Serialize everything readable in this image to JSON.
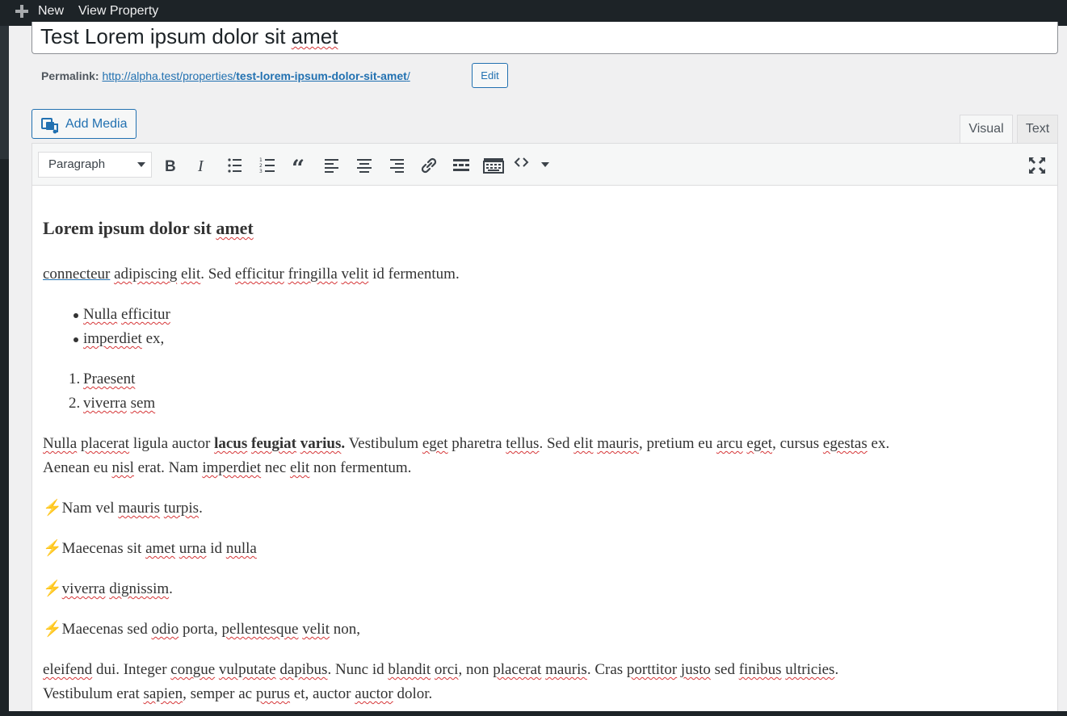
{
  "adminbar": {
    "new_label": "New",
    "view_label": "View Property"
  },
  "title": {
    "value_a": "Test Lorem ipsum dolor sit ",
    "value_b": "amet"
  },
  "permalink": {
    "label": "Permalink:",
    "url_base": "http://alpha.test/properties/",
    "slug": "test-lorem-ipsum-dolor-sit-amet",
    "url_end": "/",
    "edit_label": "Edit"
  },
  "media": {
    "add_media_label": "Add Media"
  },
  "tabs": {
    "visual": "Visual",
    "text": "Text"
  },
  "toolbar": {
    "format_value": "Paragraph"
  },
  "content": {
    "heading_a": "Lorem ipsum dolor sit ",
    "heading_b": "amet",
    "p1_a": "connecteur",
    "p1_b": "adipiscing",
    "p1_c": "elit",
    "p1_d": ". Sed ",
    "p1_e": "efficitur",
    "p1_f": "fringilla",
    "p1_g": "velit",
    "p1_h": " id fermentum.",
    "ul1_a": "Nulla",
    "ul1_b": "efficitur",
    "ul2_a": "imperdiet",
    "ul2_b": " ex,",
    "ol1_num": "1.",
    "ol1": "Praesent",
    "ol2_num": "2.",
    "ol2_a": "viverra",
    "ol2_b": "sem",
    "p2_a": "Nulla",
    "p2_b": "placerat",
    "p2_c": " ligula auctor ",
    "p2_bold_a": "lacus",
    "p2_bold_b": "feugiat",
    "p2_bold_c": "varius",
    "p2_bold_d": ".",
    "p2_d": " Vestibulum ",
    "p2_e": "eget",
    "p2_f": " pharetra ",
    "p2_g": "tellus",
    "p2_h": ". Sed ",
    "p2_i": "elit",
    "p2_j": "mauris",
    "p2_k": ", pretium eu ",
    "p2_l": "arcu",
    "p2_m": "eget",
    "p2_n": ", cursus ",
    "p2_o": "egestas",
    "p2_p": " ex.",
    "p2b_a": "Aenean eu ",
    "p2b_b": "nisl",
    "p2b_c": " erat. Nam ",
    "p2b_d": "imperdiet",
    "p2b_e": " nec ",
    "p2b_f": "elit",
    "p2b_g": " non fermentum.",
    "bolt": "⚡",
    "l1_a": "Nam vel ",
    "l1_b": "mauris",
    "l1_c": "turpis",
    "l1_d": ".",
    "l2_a": "Maecenas sit ",
    "l2_b": "amet",
    "l2_c": "urna",
    "l2_d": " id ",
    "l2_e": "nulla",
    "l3_a": "viverra",
    "l3_b": "dignissim",
    "l3_c": ".",
    "l4_a": "Maecenas sed ",
    "l4_b": "odio",
    "l4_c": " porta, ",
    "l4_d": "pellentesque",
    "l4_e": "velit",
    "l4_f": " non,",
    "p3_a": "eleifend",
    "p3_b": " dui. Integer ",
    "p3_c": "congue",
    "p3_d": "vulputate",
    "p3_e": "dapibus",
    "p3_f": ". Nunc id ",
    "p3_g": "blandit",
    "p3_h": "orci",
    "p3_i": ", non ",
    "p3_j": "placerat",
    "p3_k": "mauris",
    "p3_l": ". Cras ",
    "p3_m": "porttitor",
    "p3_n": "justo",
    "p3_o": " sed ",
    "p3_p": "finibus",
    "p3_q": "ultricies",
    "p3_r": ".",
    "p3b_a": "Vestibulum erat ",
    "p3b_b": "sapien",
    "p3b_c": ", semper ac ",
    "p3b_d": "purus",
    "p3b_e": " et, auctor ",
    "p3b_f": "auctor",
    "p3b_g": " dolor."
  },
  "icons": {
    "toolbar": [
      "bold-icon",
      "italic-icon",
      "bullet-list-icon",
      "numbered-list-icon",
      "blockquote-icon",
      "align-left-icon",
      "align-center-icon",
      "align-right-icon",
      "link-icon",
      "read-more-icon",
      "toolbar-toggle-icon",
      "code-icon",
      "fullscreen-icon"
    ]
  },
  "colors": {
    "accent": "#2271b1",
    "adminbar": "#1d2327",
    "spellcheck": "#d63638"
  }
}
